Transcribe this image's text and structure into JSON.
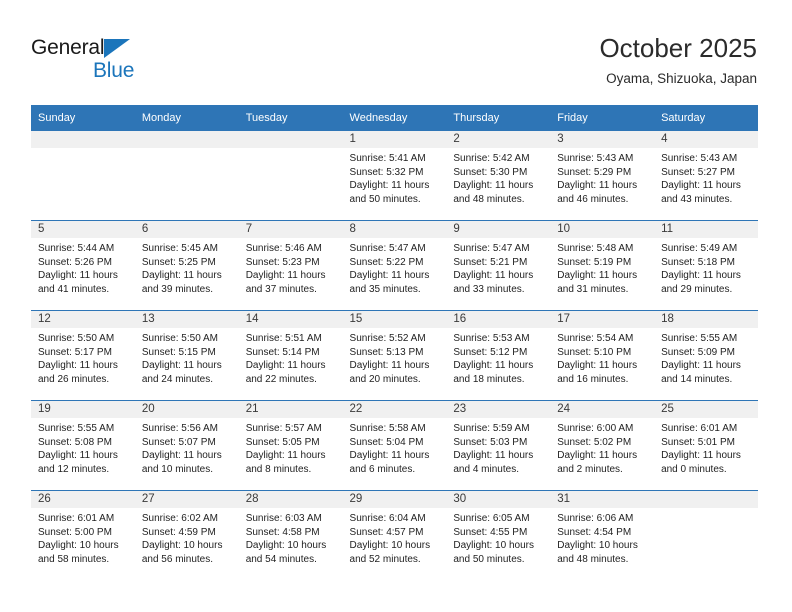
{
  "brand": {
    "name_top": "General",
    "name_bottom": "Blue",
    "accent_color": "#1b75bb"
  },
  "header": {
    "title": "October 2025",
    "location": "Oyama, Shizuoka, Japan"
  },
  "theme": {
    "header_row_color": "#2e75b6",
    "daynum_band_color": "#f0f0f0",
    "text_color": "#1f1f1f"
  },
  "weekday_headers": [
    "Sunday",
    "Monday",
    "Tuesday",
    "Wednesday",
    "Thursday",
    "Friday",
    "Saturday"
  ],
  "labels": {
    "sunrise_prefix": "Sunrise:",
    "sunset_prefix": "Sunset:",
    "daylight_prefix": "Daylight:"
  },
  "weeks": [
    [
      {
        "day": "",
        "empty": true
      },
      {
        "day": "",
        "empty": true
      },
      {
        "day": "",
        "empty": true
      },
      {
        "day": "1",
        "sunrise": "Sunrise: 5:41 AM",
        "sunset": "Sunset: 5:32 PM",
        "daylight1": "Daylight: 11 hours",
        "daylight2": "and 50 minutes."
      },
      {
        "day": "2",
        "sunrise": "Sunrise: 5:42 AM",
        "sunset": "Sunset: 5:30 PM",
        "daylight1": "Daylight: 11 hours",
        "daylight2": "and 48 minutes."
      },
      {
        "day": "3",
        "sunrise": "Sunrise: 5:43 AM",
        "sunset": "Sunset: 5:29 PM",
        "daylight1": "Daylight: 11 hours",
        "daylight2": "and 46 minutes."
      },
      {
        "day": "4",
        "sunrise": "Sunrise: 5:43 AM",
        "sunset": "Sunset: 5:27 PM",
        "daylight1": "Daylight: 11 hours",
        "daylight2": "and 43 minutes."
      }
    ],
    [
      {
        "day": "5",
        "sunrise": "Sunrise: 5:44 AM",
        "sunset": "Sunset: 5:26 PM",
        "daylight1": "Daylight: 11 hours",
        "daylight2": "and 41 minutes."
      },
      {
        "day": "6",
        "sunrise": "Sunrise: 5:45 AM",
        "sunset": "Sunset: 5:25 PM",
        "daylight1": "Daylight: 11 hours",
        "daylight2": "and 39 minutes."
      },
      {
        "day": "7",
        "sunrise": "Sunrise: 5:46 AM",
        "sunset": "Sunset: 5:23 PM",
        "daylight1": "Daylight: 11 hours",
        "daylight2": "and 37 minutes."
      },
      {
        "day": "8",
        "sunrise": "Sunrise: 5:47 AM",
        "sunset": "Sunset: 5:22 PM",
        "daylight1": "Daylight: 11 hours",
        "daylight2": "and 35 minutes."
      },
      {
        "day": "9",
        "sunrise": "Sunrise: 5:47 AM",
        "sunset": "Sunset: 5:21 PM",
        "daylight1": "Daylight: 11 hours",
        "daylight2": "and 33 minutes."
      },
      {
        "day": "10",
        "sunrise": "Sunrise: 5:48 AM",
        "sunset": "Sunset: 5:19 PM",
        "daylight1": "Daylight: 11 hours",
        "daylight2": "and 31 minutes."
      },
      {
        "day": "11",
        "sunrise": "Sunrise: 5:49 AM",
        "sunset": "Sunset: 5:18 PM",
        "daylight1": "Daylight: 11 hours",
        "daylight2": "and 29 minutes."
      }
    ],
    [
      {
        "day": "12",
        "sunrise": "Sunrise: 5:50 AM",
        "sunset": "Sunset: 5:17 PM",
        "daylight1": "Daylight: 11 hours",
        "daylight2": "and 26 minutes."
      },
      {
        "day": "13",
        "sunrise": "Sunrise: 5:50 AM",
        "sunset": "Sunset: 5:15 PM",
        "daylight1": "Daylight: 11 hours",
        "daylight2": "and 24 minutes."
      },
      {
        "day": "14",
        "sunrise": "Sunrise: 5:51 AM",
        "sunset": "Sunset: 5:14 PM",
        "daylight1": "Daylight: 11 hours",
        "daylight2": "and 22 minutes."
      },
      {
        "day": "15",
        "sunrise": "Sunrise: 5:52 AM",
        "sunset": "Sunset: 5:13 PM",
        "daylight1": "Daylight: 11 hours",
        "daylight2": "and 20 minutes."
      },
      {
        "day": "16",
        "sunrise": "Sunrise: 5:53 AM",
        "sunset": "Sunset: 5:12 PM",
        "daylight1": "Daylight: 11 hours",
        "daylight2": "and 18 minutes."
      },
      {
        "day": "17",
        "sunrise": "Sunrise: 5:54 AM",
        "sunset": "Sunset: 5:10 PM",
        "daylight1": "Daylight: 11 hours",
        "daylight2": "and 16 minutes."
      },
      {
        "day": "18",
        "sunrise": "Sunrise: 5:55 AM",
        "sunset": "Sunset: 5:09 PM",
        "daylight1": "Daylight: 11 hours",
        "daylight2": "and 14 minutes."
      }
    ],
    [
      {
        "day": "19",
        "sunrise": "Sunrise: 5:55 AM",
        "sunset": "Sunset: 5:08 PM",
        "daylight1": "Daylight: 11 hours",
        "daylight2": "and 12 minutes."
      },
      {
        "day": "20",
        "sunrise": "Sunrise: 5:56 AM",
        "sunset": "Sunset: 5:07 PM",
        "daylight1": "Daylight: 11 hours",
        "daylight2": "and 10 minutes."
      },
      {
        "day": "21",
        "sunrise": "Sunrise: 5:57 AM",
        "sunset": "Sunset: 5:05 PM",
        "daylight1": "Daylight: 11 hours",
        "daylight2": "and 8 minutes."
      },
      {
        "day": "22",
        "sunrise": "Sunrise: 5:58 AM",
        "sunset": "Sunset: 5:04 PM",
        "daylight1": "Daylight: 11 hours",
        "daylight2": "and 6 minutes."
      },
      {
        "day": "23",
        "sunrise": "Sunrise: 5:59 AM",
        "sunset": "Sunset: 5:03 PM",
        "daylight1": "Daylight: 11 hours",
        "daylight2": "and 4 minutes."
      },
      {
        "day": "24",
        "sunrise": "Sunrise: 6:00 AM",
        "sunset": "Sunset: 5:02 PM",
        "daylight1": "Daylight: 11 hours",
        "daylight2": "and 2 minutes."
      },
      {
        "day": "25",
        "sunrise": "Sunrise: 6:01 AM",
        "sunset": "Sunset: 5:01 PM",
        "daylight1": "Daylight: 11 hours",
        "daylight2": "and 0 minutes."
      }
    ],
    [
      {
        "day": "26",
        "sunrise": "Sunrise: 6:01 AM",
        "sunset": "Sunset: 5:00 PM",
        "daylight1": "Daylight: 10 hours",
        "daylight2": "and 58 minutes."
      },
      {
        "day": "27",
        "sunrise": "Sunrise: 6:02 AM",
        "sunset": "Sunset: 4:59 PM",
        "daylight1": "Daylight: 10 hours",
        "daylight2": "and 56 minutes."
      },
      {
        "day": "28",
        "sunrise": "Sunrise: 6:03 AM",
        "sunset": "Sunset: 4:58 PM",
        "daylight1": "Daylight: 10 hours",
        "daylight2": "and 54 minutes."
      },
      {
        "day": "29",
        "sunrise": "Sunrise: 6:04 AM",
        "sunset": "Sunset: 4:57 PM",
        "daylight1": "Daylight: 10 hours",
        "daylight2": "and 52 minutes."
      },
      {
        "day": "30",
        "sunrise": "Sunrise: 6:05 AM",
        "sunset": "Sunset: 4:55 PM",
        "daylight1": "Daylight: 10 hours",
        "daylight2": "and 50 minutes."
      },
      {
        "day": "31",
        "sunrise": "Sunrise: 6:06 AM",
        "sunset": "Sunset: 4:54 PM",
        "daylight1": "Daylight: 10 hours",
        "daylight2": "and 48 minutes."
      },
      {
        "day": "",
        "empty": true
      }
    ]
  ]
}
